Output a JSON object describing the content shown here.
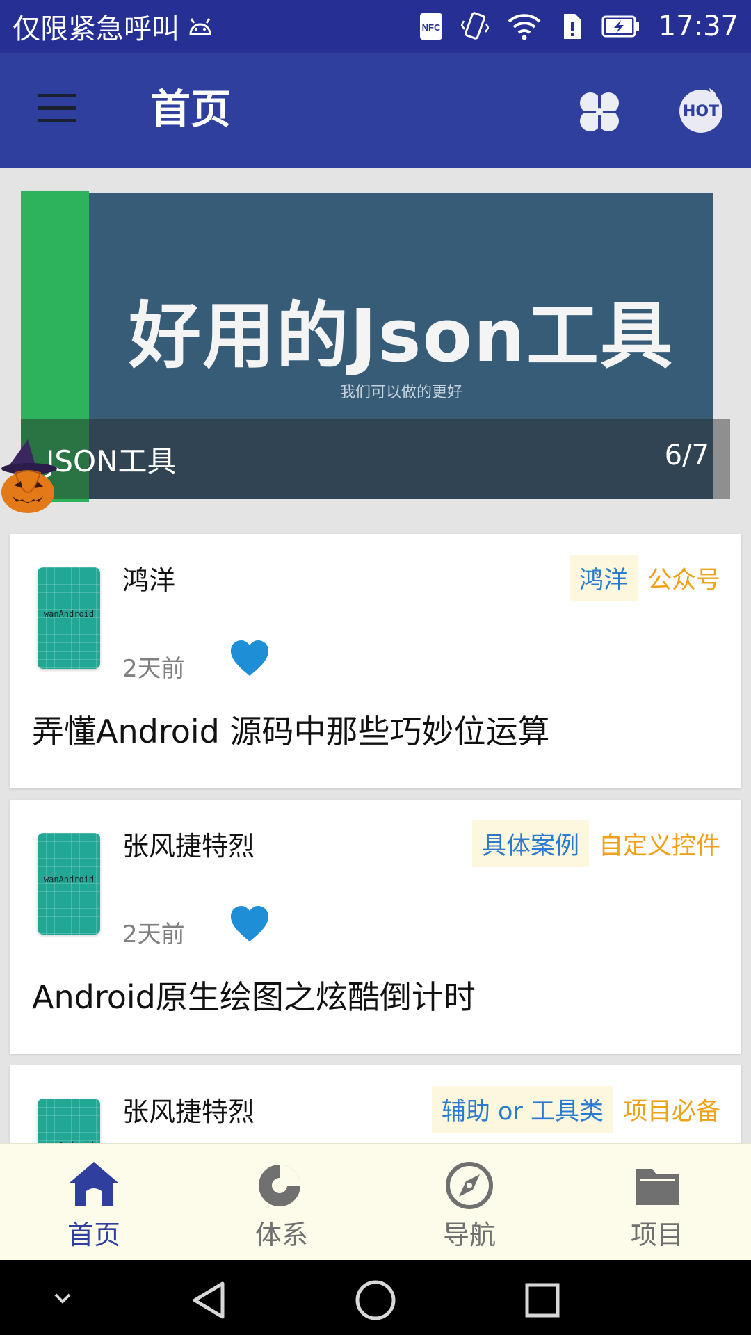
{
  "status_bar": {
    "carrier": "仅限紧急呼叫",
    "time": "17:37",
    "nfc": "NFC"
  },
  "toolbar": {
    "title": "首页",
    "hot_label": "HOT"
  },
  "banner": {
    "slide_title": "好用的Json工具",
    "slide_subtitle": "我们可以做的更好",
    "caption": "JSON工具",
    "counter": "6/7"
  },
  "articles": [
    {
      "author": "鸿洋",
      "chapter_tag": "鸿洋",
      "super_tag": "公众号",
      "date": "2天前",
      "title": "弄懂Android 源码中那些巧妙位运算",
      "thumb_label": "wanAndroid",
      "liked": true
    },
    {
      "author": "张风捷特烈",
      "chapter_tag": "具体案例",
      "super_tag": "自定义控件",
      "date": "2天前",
      "title": "Android原生绘图之炫酷倒计时",
      "thumb_label": "wanAndroid",
      "liked": true
    },
    {
      "author": "张风捷特烈",
      "chapter_tag": "辅助 or 工具类",
      "super_tag": "项目必备",
      "thumb_label": "wanAndroid"
    }
  ],
  "bottom_nav": [
    {
      "label": "首页",
      "icon": "home-icon",
      "active": true
    },
    {
      "label": "体系",
      "icon": "pie-chart-icon",
      "active": false
    },
    {
      "label": "导航",
      "icon": "compass-icon",
      "active": false
    },
    {
      "label": "项目",
      "icon": "folder-icon",
      "active": false
    }
  ],
  "colors": {
    "primary": "#2f3f9e",
    "status_bar": "#263094",
    "chapter_tag_text": "#2a7bd0",
    "chapter_tag_bg": "#fdf7dd",
    "super_tag_text": "#f0a117",
    "heart": "#1e8fd6",
    "bottom_nav_bg": "#fdfcea"
  }
}
